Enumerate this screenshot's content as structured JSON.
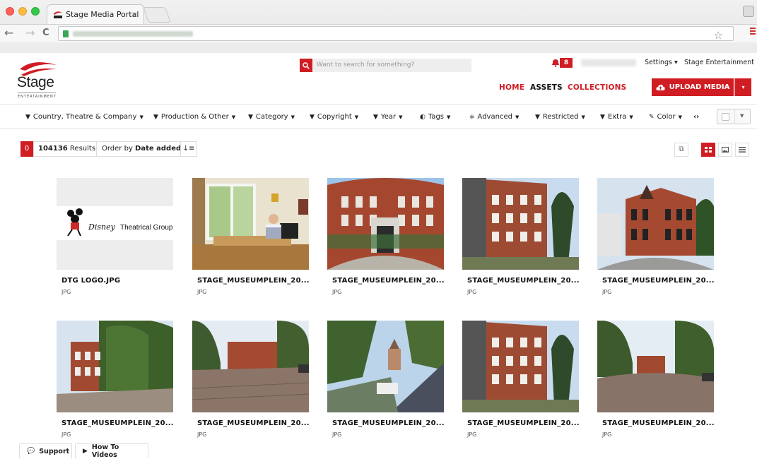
{
  "browser": {
    "tab_title": "Stage Media Portal",
    "tab_close": "×",
    "back": "←",
    "forward": "→",
    "reload": "C",
    "star": "☆"
  },
  "header": {
    "logo_text": "Stage",
    "logo_sub": "ENTERTAINMENT",
    "search_placeholder": "Want to search for something?",
    "notification_count": "8",
    "settings_label": "Settings ▾",
    "company_label": "Stage Entertainment",
    "nav": {
      "home": "HOME",
      "assets": "ASSETS",
      "collections": "COLLECTIONS"
    },
    "upload_label": "UPLOAD MEDIA",
    "upload_caret": "▾",
    "accent_color": "#d01d24"
  },
  "filters": [
    {
      "label": "Country, Theatre & Company",
      "icon": "filter-icon"
    },
    {
      "label": "Production & Other",
      "icon": "filter-icon"
    },
    {
      "label": "Category",
      "icon": "filter-icon"
    },
    {
      "label": "Copyright",
      "icon": "filter-icon"
    },
    {
      "label": "Year",
      "icon": "filter-icon"
    },
    {
      "label": "Tags",
      "icon": "tag-toggle-icon"
    },
    {
      "label": "Advanced",
      "icon": "sliders-icon"
    },
    {
      "label": "Restricted",
      "icon": "filter-icon"
    },
    {
      "label": "Extra",
      "icon": "filter-icon"
    },
    {
      "label": "Color",
      "icon": "eyedropper-icon"
    }
  ],
  "filter_scroll": "‹›",
  "results_bar": {
    "selected_count": "0",
    "results_count": "104136",
    "results_label": " Results",
    "order_prefix": "Order by ",
    "order_value": "Date added",
    "order_caret": " ▾",
    "sort_dir": "↓≡"
  },
  "assets": [
    {
      "title": "DTG LOGO.JPG",
      "type": "JPG",
      "thumb": "disney-logo",
      "logo_text": "Theatrical Group",
      "logo_brand": "Disney"
    },
    {
      "title": "STAGE_MUSEUMPLEIN_20...",
      "type": "JPG",
      "thumb": "office"
    },
    {
      "title": "STAGE_MUSEUMPLEIN_20...",
      "type": "JPG",
      "thumb": "building-front"
    },
    {
      "title": "STAGE_MUSEUMPLEIN_20...",
      "type": "JPG",
      "thumb": "building-side"
    },
    {
      "title": "STAGE_MUSEUMPLEIN_20...",
      "type": "JPG",
      "thumb": "building-corner"
    },
    {
      "title": "STAGE_MUSEUMPLEIN_20...",
      "type": "JPG",
      "thumb": "ivy-building"
    },
    {
      "title": "STAGE_MUSEUMPLEIN_20...",
      "type": "JPG",
      "thumb": "street"
    },
    {
      "title": "STAGE_MUSEUMPLEIN_20...",
      "type": "JPG",
      "thumb": "rooftop-view"
    },
    {
      "title": "STAGE_MUSEUMPLEIN_20...",
      "type": "JPG",
      "thumb": "building-side"
    },
    {
      "title": "STAGE_MUSEUMPLEIN_20...",
      "type": "JPG",
      "thumb": "street-wide"
    }
  ],
  "footer": {
    "support": "Support",
    "howto": "How To Videos"
  }
}
